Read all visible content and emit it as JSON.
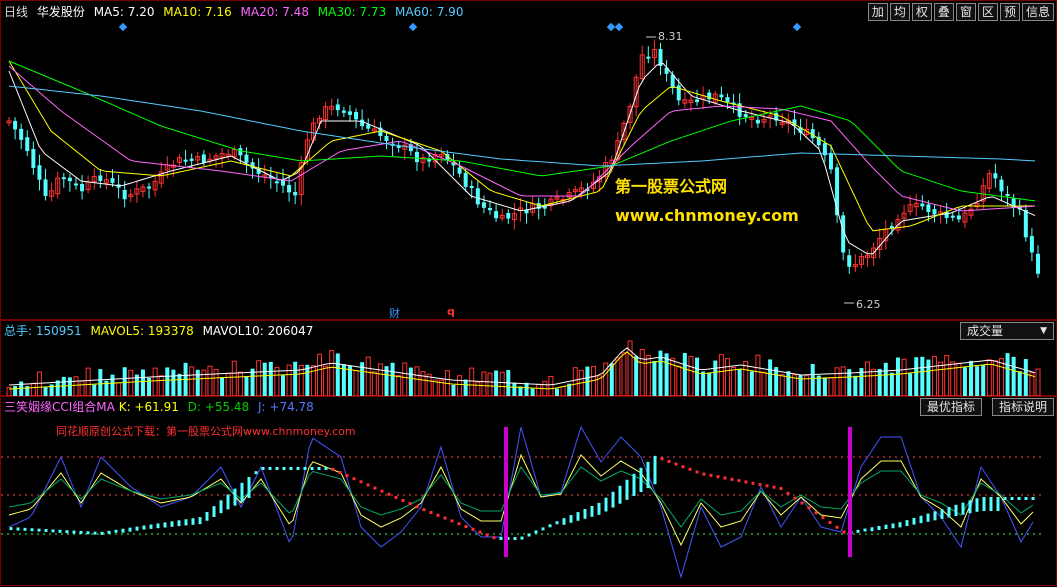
{
  "main": {
    "period": "日线",
    "stock": "华发股份",
    "ma": [
      {
        "label": "MA5: 7.20",
        "color": "#ffffff"
      },
      {
        "label": "MA10: 7.16",
        "color": "#ffff00"
      },
      {
        "label": "MA20: 7.48",
        "color": "#ff66ff"
      },
      {
        "label": "MA30: 7.73",
        "color": "#00ff00"
      },
      {
        "label": "MA60: 7.90",
        "color": "#55ccff"
      }
    ],
    "toolbar": [
      "加",
      "均",
      "权",
      "叠",
      "窗",
      "区",
      "预",
      "信息"
    ],
    "high_label": "8.31",
    "low_label": "6.25",
    "event1": "财",
    "event2": "q",
    "watermark1": "第一股票公式网",
    "watermark2": "www.chnmoney.com"
  },
  "volume": {
    "total": "总手: 150951",
    "mavol5": "MAVOL5: 193378",
    "mavol10": "MAVOL10: 206047",
    "dropdown": "成交量",
    "dropdown_arrow": "▼"
  },
  "indicator": {
    "name": "三笑姻缘CCI组合MA",
    "k": "K: +61.91",
    "d": "D: +55.48",
    "j": "J: +74.78",
    "btn_best": "最优指标",
    "btn_help": "指标说明",
    "note": "同花顺原创公式下载：第一股票公式网www.chnmoney.com"
  },
  "colors": {
    "up": "#ff3232",
    "down": "#54ffff",
    "border": "#7a0000"
  }
}
